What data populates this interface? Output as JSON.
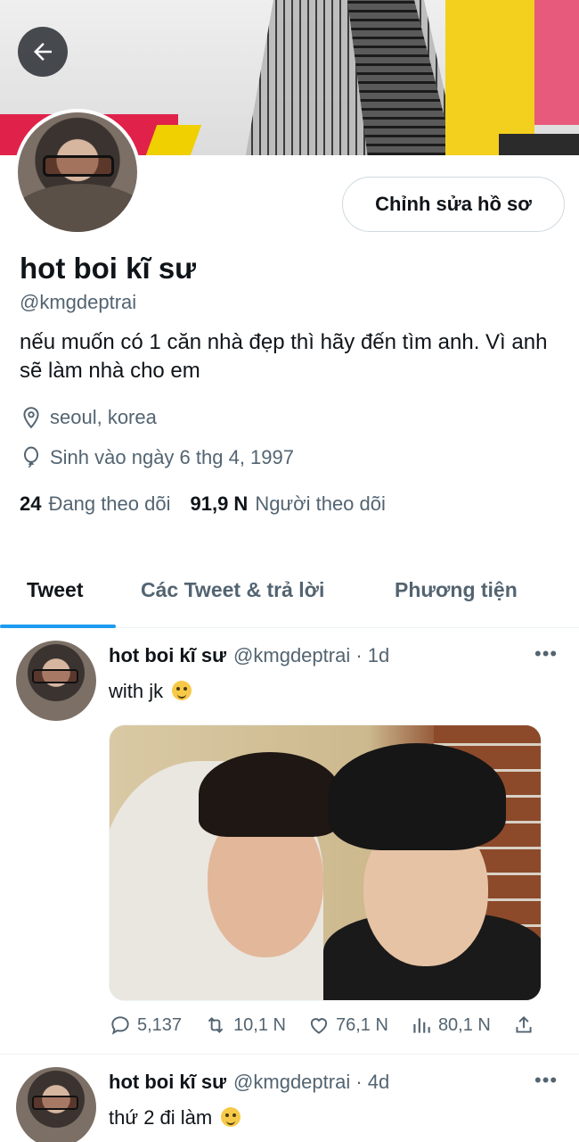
{
  "profile": {
    "display_name": "hot boi kĩ sư",
    "handle": "@kmgdeptrai",
    "bio": "nếu muốn có 1 căn nhà đẹp thì hãy đến tìm anh. Vì anh sẽ làm nhà cho em",
    "location": "seoul, korea",
    "birthday": "Sinh vào ngày 6 thg 4, 1997",
    "following_count": "24",
    "following_label": "Đang theo dõi",
    "followers_count": "91,9 N",
    "followers_label": "Người theo dõi",
    "edit_button_label": "Chỉnh sửa hồ sơ"
  },
  "icons": {
    "back": "arrow-left-icon",
    "location": "location-pin-icon",
    "birthday": "balloon-icon",
    "reply": "reply-icon",
    "retweet": "retweet-icon",
    "like": "heart-icon",
    "views": "views-chart-icon",
    "share": "share-icon",
    "more": "more-options-icon"
  },
  "tabs": [
    {
      "label": "Tweet",
      "active": true
    },
    {
      "label": "Các Tweet & trả lời",
      "active": false
    },
    {
      "label": "Phương tiện",
      "active": false
    }
  ],
  "tweets": [
    {
      "name": "hot boi kĩ sư",
      "meta": "@kmgdeptrai · 1d",
      "text": "with jk",
      "more": "•••",
      "replies": "5,137",
      "retweets": "10,1 N",
      "likes": "76,1 N",
      "views": "80,1 N"
    },
    {
      "name": "hot boi kĩ sư",
      "meta": "@kmgdeptrai · 4d",
      "text": "thứ 2 đi làm",
      "more": "•••"
    }
  ],
  "colors": {
    "accent": "#1d9bf0",
    "text_primary": "#0f1419",
    "text_secondary": "#536471",
    "border": "#cfd9de"
  }
}
